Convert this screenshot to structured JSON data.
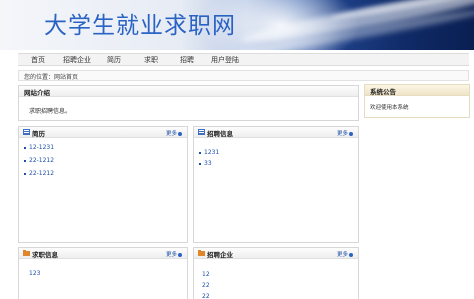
{
  "header": {
    "site_title": "大学生就业求职网"
  },
  "nav": {
    "items": [
      "首页",
      "招聘企业",
      "简历",
      "求职",
      "招聘",
      "用户登陆"
    ]
  },
  "breadcrumb": {
    "text": "您的位置：网站首页"
  },
  "intro": {
    "title": "网站介绍",
    "text": "求职招聘信息。"
  },
  "notice": {
    "title": "系统公告",
    "text": "欢迎使用本系统"
  },
  "resume": {
    "title": "简历",
    "more": "更多",
    "items": [
      "12-1231",
      "22-1212",
      "22-1212"
    ]
  },
  "recruit_info": {
    "title": "招聘信息",
    "more": "更多",
    "items": [
      "1231",
      "33"
    ]
  },
  "jobseek_info": {
    "title": "求职信息",
    "more": "更多",
    "items": [
      "123"
    ]
  },
  "companies": {
    "title": "招聘企业",
    "more": "更多",
    "items": [
      "12",
      "22",
      "22"
    ]
  },
  "colors": {
    "link": "#1d4fa8",
    "title_blue": "#2a63c4",
    "banner_dark": "#0f2a66"
  },
  "icons": {
    "resume": "document-icon",
    "recruit": "document-icon",
    "jobseek": "folder-icon",
    "company": "folder-icon",
    "more": "arrow-right-icon"
  }
}
